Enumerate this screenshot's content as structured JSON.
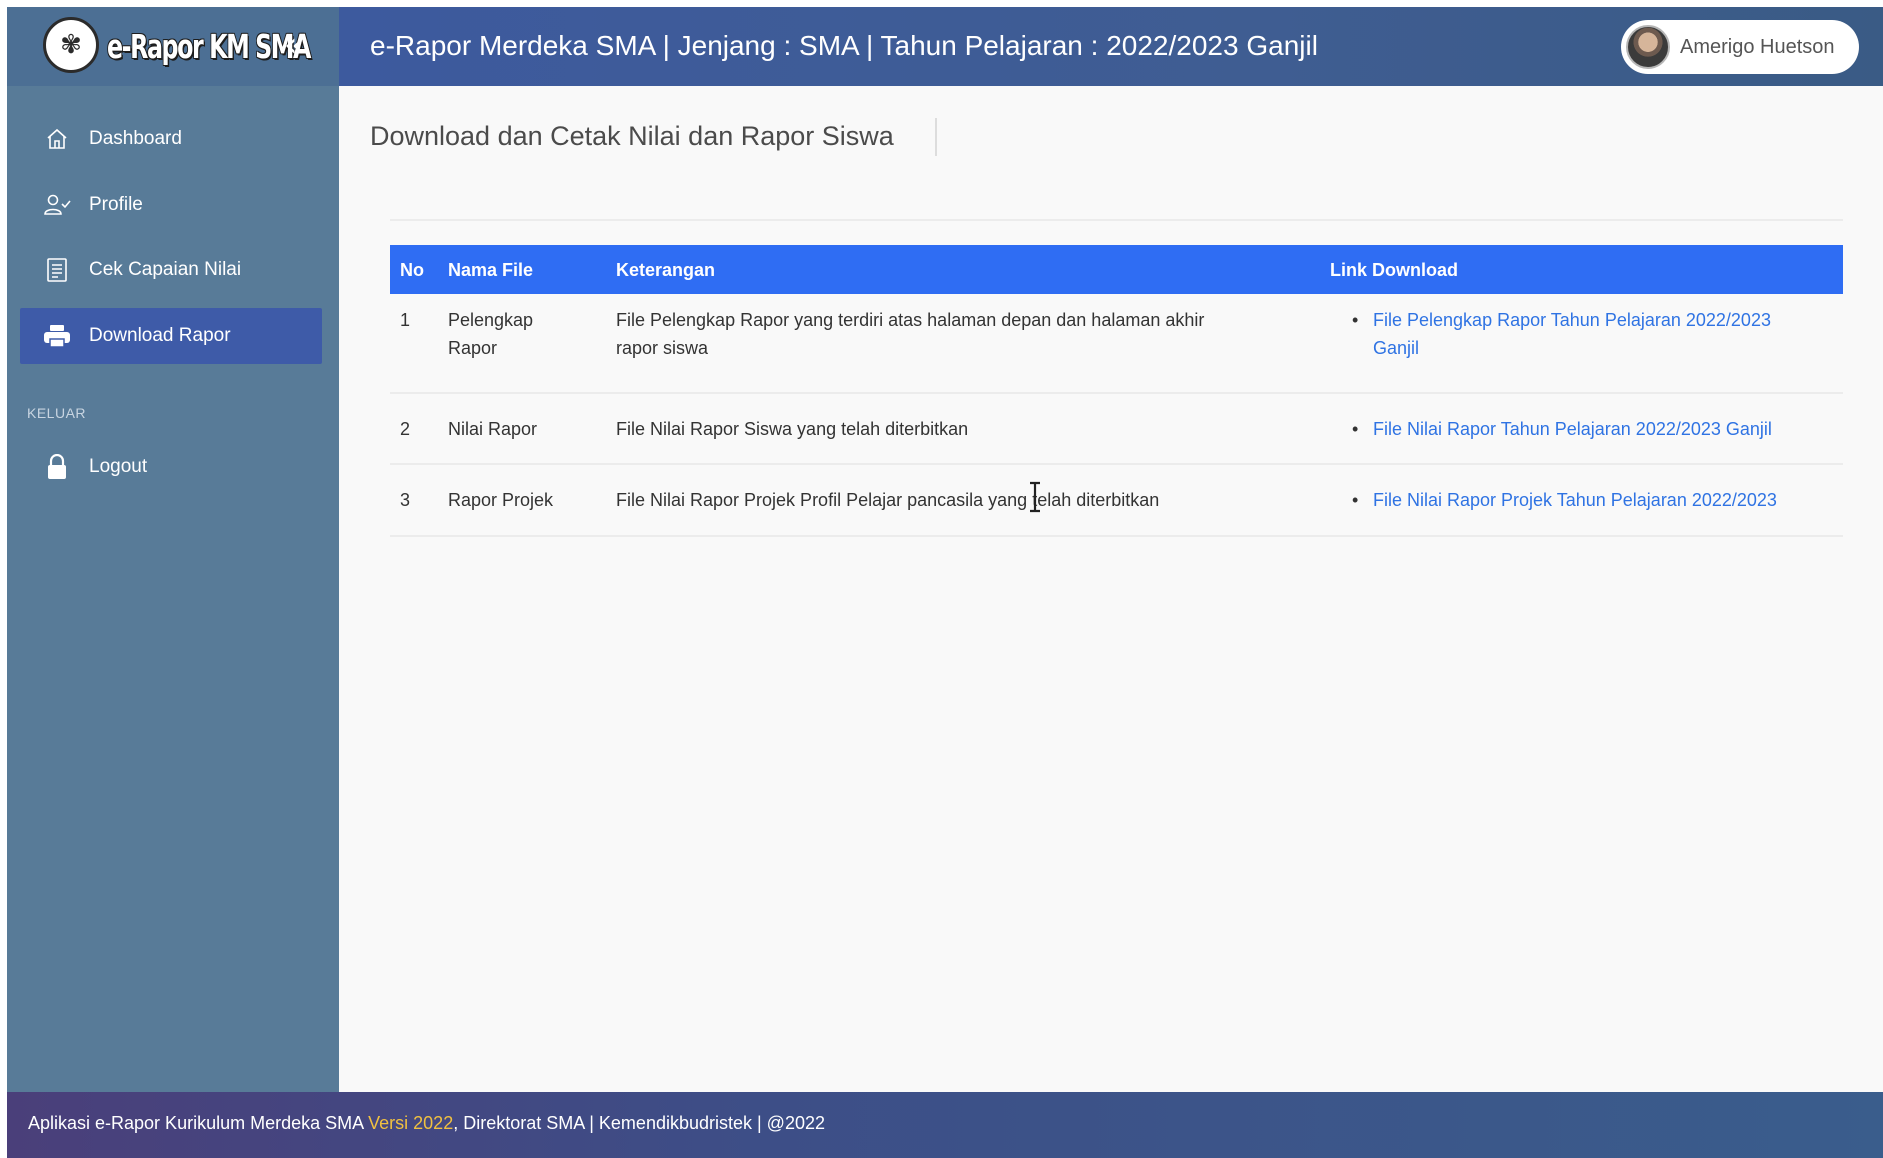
{
  "brand": {
    "logo_text": "e-Rapor KM SMA",
    "collapse_icon": "double-chevron-left-icon"
  },
  "header": {
    "title": "e-Rapor Merdeka SMA | Jenjang : SMA | Tahun Pelajaran : 2022/2023 Ganjil",
    "user_name": "Amerigo Huetson"
  },
  "sidebar": {
    "items": [
      {
        "label": "Dashboard",
        "icon": "home-icon"
      },
      {
        "label": "Profile",
        "icon": "user-check-icon"
      },
      {
        "label": "Cek Capaian Nilai",
        "icon": "document-list-icon"
      },
      {
        "label": "Download Rapor",
        "icon": "printer-icon",
        "active": true
      }
    ],
    "section_label": "KELUAR",
    "logout": {
      "label": "Logout",
      "icon": "lock-icon"
    }
  },
  "main": {
    "page_title": "Download dan Cetak Nilai dan Rapor Siswa",
    "table": {
      "headers": [
        "No",
        "Nama File",
        "Keterangan",
        "Link Download"
      ],
      "rows": [
        {
          "no": "1",
          "nama_line1": "Pelengkap",
          "nama_line2": "Rapor",
          "ket_line1": "File Pelengkap Rapor yang terdiri atas halaman depan dan halaman akhir",
          "ket_line2": "rapor siswa",
          "link_line1": "File Pelengkap Rapor Tahun Pelajaran 2022/2023",
          "link_line2": "Ganjil"
        },
        {
          "no": "2",
          "nama": "Nilai Rapor",
          "ket": "File Nilai Rapor Siswa yang telah diterbitkan",
          "link": "File Nilai Rapor Tahun Pelajaran 2022/2023 Ganjil"
        },
        {
          "no": "3",
          "nama": "Rapor Projek",
          "ket": "File Nilai Rapor Projek Profil Pelajar pancasila yang telah diterbitkan",
          "link": "File Nilai Rapor Projek Tahun Pelajaran 2022/2023"
        }
      ]
    }
  },
  "footer": {
    "text_before": "Aplikasi e-Rapor Kurikulum Merdeka SMA ",
    "version": "Versi 2022",
    "text_after": ", Direktorat SMA | Kemendikbudristek | @2022"
  },
  "colors": {
    "sidebar": "#587b98",
    "active_item": "#3e5ba8",
    "table_header": "#2f6df3",
    "link": "#2f73e3",
    "footer_version": "#f0c040"
  }
}
